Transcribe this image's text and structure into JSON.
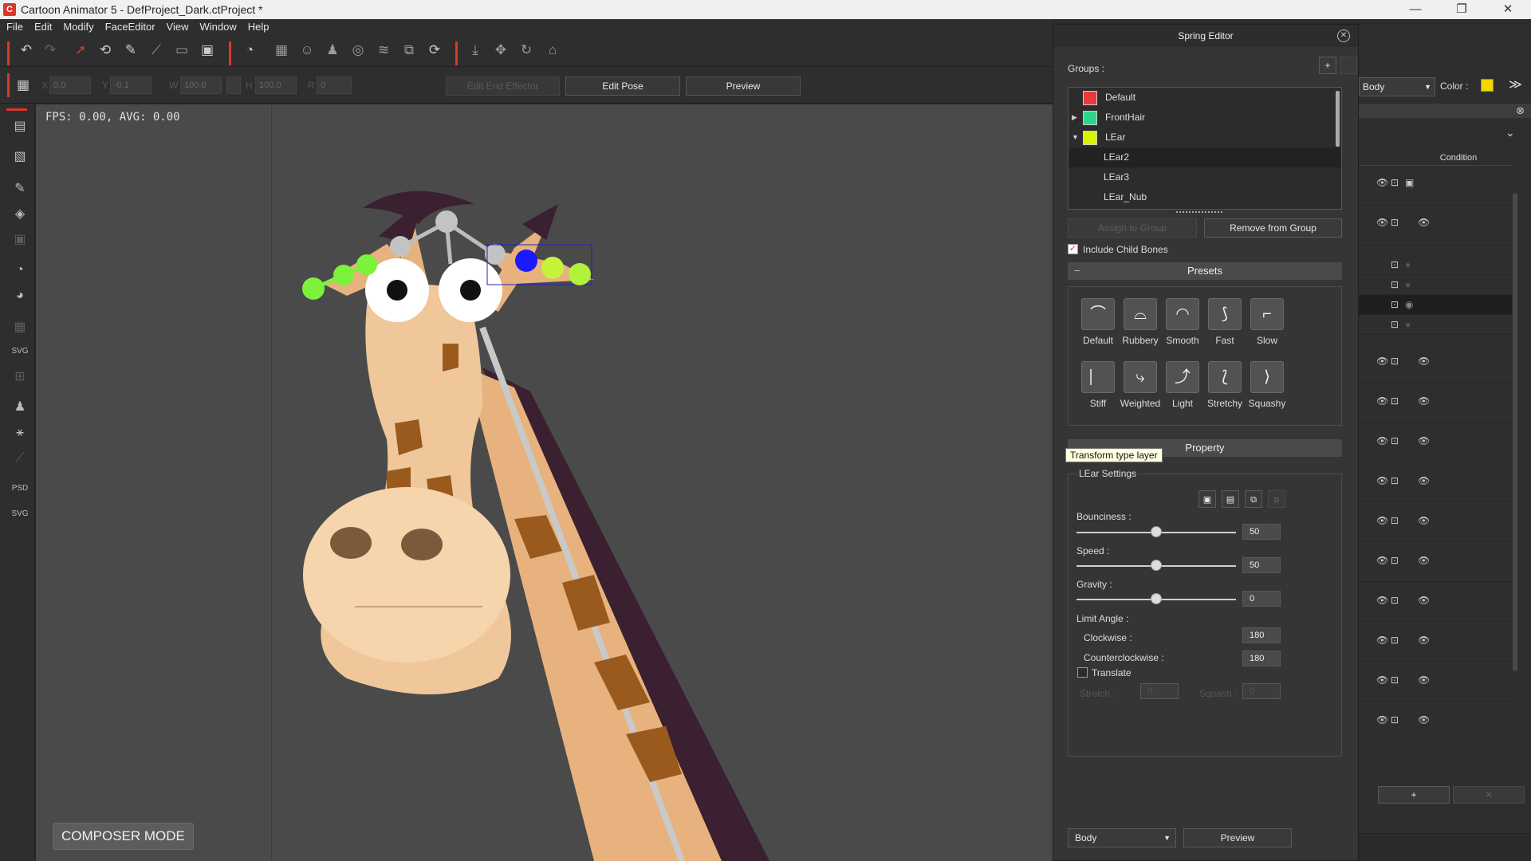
{
  "window": {
    "title": "Cartoon Animator 5 - DefProject_Dark.ctProject *"
  },
  "menu": [
    "File",
    "Edit",
    "Modify",
    "FaceEditor",
    "View",
    "Window",
    "Help"
  ],
  "transform": {
    "x_label": "X",
    "x_value": "0.0",
    "y_label": "Y",
    "y_value": "-0.1",
    "w_label": "W",
    "w_value": "100.0",
    "h_label": "H",
    "h_value": "100.0",
    "r_label": "R",
    "r_value": "0",
    "edit_end_effector": "Edit End Effector",
    "edit_pose": "Edit Pose",
    "preview": "Preview"
  },
  "viewport": {
    "fps": "FPS: 0.00, AVG: 0.00",
    "composer_mode": "COMPOSER MODE"
  },
  "spring_editor": {
    "title": "Spring Editor",
    "groups_label": "Groups :",
    "add_label": "+",
    "groups": [
      {
        "name": "Default",
        "color": "#e83a3a",
        "level": 0,
        "arrow": ""
      },
      {
        "name": "FrontHair",
        "color": "#2fd58a",
        "level": 0,
        "arrow": "▶"
      },
      {
        "name": "LEar",
        "color": "#d8f200",
        "level": 0,
        "arrow": "▼"
      },
      {
        "name": "LEar2",
        "color": "",
        "level": 1,
        "arrow": ""
      },
      {
        "name": "LEar3",
        "color": "",
        "level": 1,
        "arrow": ""
      },
      {
        "name": "LEar_Nub",
        "color": "",
        "level": 1,
        "arrow": ""
      }
    ],
    "assign_to_group": "Assign to Group",
    "remove_from_group": "Remove from Group",
    "include_child_bones": "Include Child Bones",
    "presets_title": "Presets",
    "presets": [
      "Default",
      "Rubbery",
      "Smooth",
      "Fast",
      "Slow",
      "Stiff",
      "Weighted",
      "Light",
      "Stretchy",
      "Squashy"
    ],
    "tooltip": "Transform type layer",
    "property_title": "Property",
    "settings_title": "LEar Settings",
    "bounciness_label": "Bounciness :",
    "bounciness": "50",
    "speed_label": "Speed :",
    "speed": "50",
    "gravity_label": "Gravity :",
    "gravity": "0",
    "limit_angle_label": "Limit Angle :",
    "clockwise_label": "Clockwise :",
    "clockwise": "180",
    "counterclockwise_label": "Counterclockwise :",
    "counterclockwise": "180",
    "translate_label": "Translate",
    "stretch_label": "Stretch :",
    "stretch": "0",
    "squash_label": "Squash :",
    "squash": "0",
    "body_select": "Body",
    "preview": "Preview"
  },
  "right_panel": {
    "body_select": "Body",
    "color_label": "Color :",
    "color_swatch": "#f2d600",
    "condition_header": "Condition",
    "add_label": "+",
    "remove_label": "✕"
  },
  "colors": {
    "accent": "#d9372b",
    "selected_green": "#7cf23c",
    "selected_blue": "#1a1aff"
  }
}
